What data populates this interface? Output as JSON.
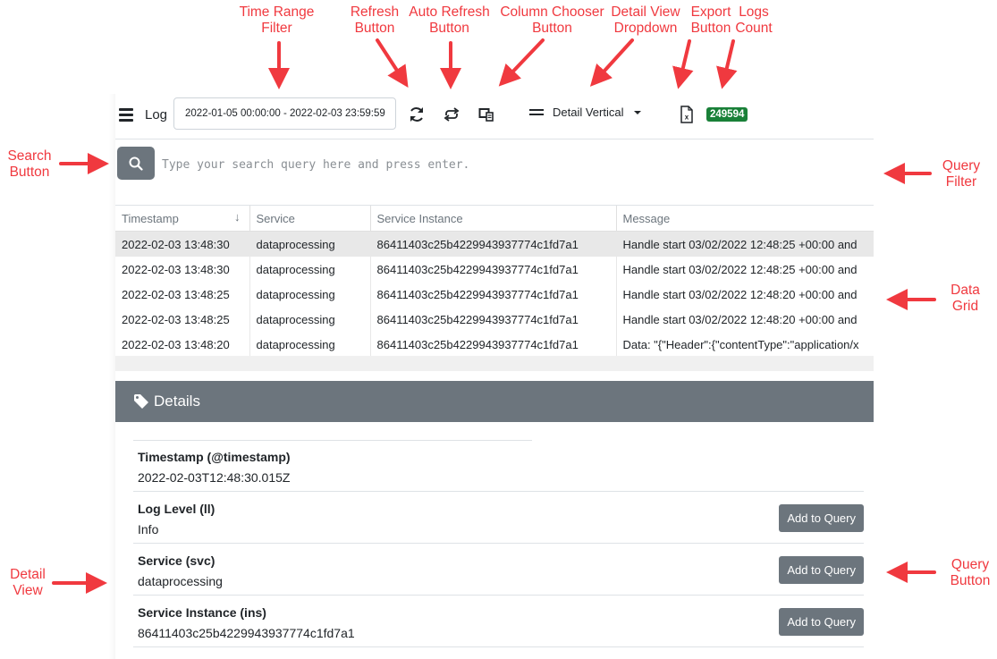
{
  "toolbar": {
    "menu_icon": "hamburger-icon",
    "title": "Log",
    "time_range": "2022-01-05 00:00:00 - 2022-02-03 23:59:59",
    "refresh_icon": "refresh-icon",
    "auto_refresh_icon": "repeat-icon",
    "column_chooser_icon": "columns-icon",
    "detail_view": "Detail Vertical",
    "export_icon": "excel-file-icon",
    "logs_count": "249594"
  },
  "search": {
    "button_icon": "search-icon",
    "placeholder": "Type your search query here and press enter.",
    "value": ""
  },
  "grid": {
    "columns": [
      "Timestamp",
      "Service",
      "Service Instance",
      "Message"
    ],
    "sort": {
      "column": "Timestamp",
      "direction": "descending"
    },
    "rows": [
      {
        "timestamp": "2022-02-03 13:48:30",
        "service": "dataprocessing",
        "instance": "86411403c25b4229943937774c1fd7a1",
        "message": "Handle start 03/02/2022 12:48:25 +00:00 and",
        "selected": true
      },
      {
        "timestamp": "2022-02-03 13:48:30",
        "service": "dataprocessing",
        "instance": "86411403c25b4229943937774c1fd7a1",
        "message": "Handle start 03/02/2022 12:48:25 +00:00 and"
      },
      {
        "timestamp": "2022-02-03 13:48:25",
        "service": "dataprocessing",
        "instance": "86411403c25b4229943937774c1fd7a1",
        "message": "Handle start 03/02/2022 12:48:20 +00:00 and"
      },
      {
        "timestamp": "2022-02-03 13:48:25",
        "service": "dataprocessing",
        "instance": "86411403c25b4229943937774c1fd7a1",
        "message": "Handle start 03/02/2022 12:48:20 +00:00 and"
      },
      {
        "timestamp": "2022-02-03 13:48:20",
        "service": "dataprocessing",
        "instance": "86411403c25b4229943937774c1fd7a1",
        "message": "Data: \"{\"Header\":{\"contentType\":\"application/x"
      }
    ]
  },
  "details": {
    "title": "Details",
    "icon": "tag-icon",
    "add_label": "Add to Query",
    "fields": [
      {
        "label": "Timestamp (@timestamp)",
        "value": "2022-02-03T12:48:30.015Z",
        "addable": false
      },
      {
        "label": "Log Level (ll)",
        "value": "Info",
        "addable": true
      },
      {
        "label": "Service (svc)",
        "value": "dataprocessing",
        "addable": true
      },
      {
        "label": "Service Instance (ins)",
        "value": "86411403c25b4229943937774c1fd7a1",
        "addable": true
      }
    ]
  },
  "annotations": {
    "time_range": "Time Range\nFilter",
    "refresh": "Refresh\nButton",
    "auto_refresh": "Auto Refresh\nButton",
    "column_chooser": "Column Chooser\nButton",
    "detail_view_dd": "Detail View\nDropdown",
    "export": "Export\nButton",
    "logs_count": "Logs\nCount",
    "search_button": "Search\nButton",
    "query_filter": "Query\nFilter",
    "data_grid": "Data\nGrid",
    "detail_view": "Detail\nView",
    "query_button": "Query\nButton",
    "color": "#f0393f"
  }
}
